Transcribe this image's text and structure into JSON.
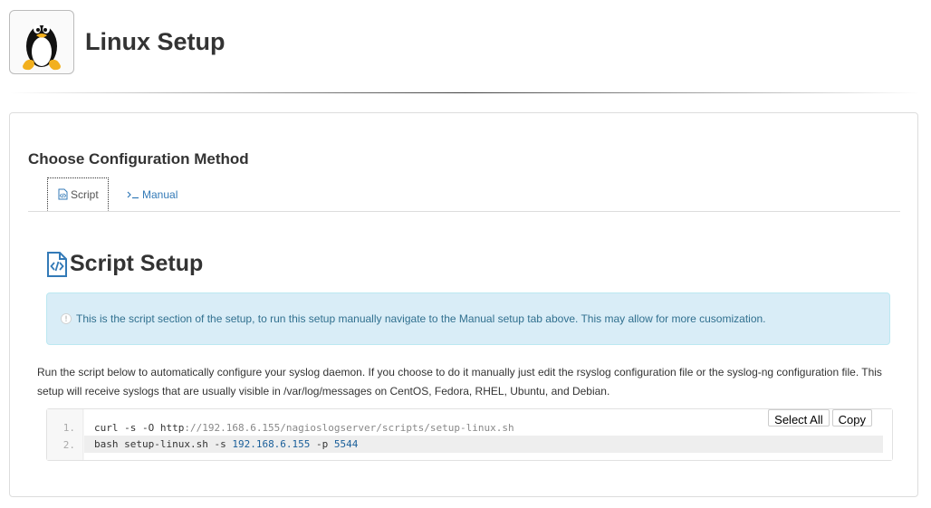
{
  "header": {
    "title": "Linux Setup",
    "logo_icon": "tux-penguin-icon"
  },
  "section": {
    "heading": "Choose Configuration Method"
  },
  "tabs": [
    {
      "label": "Script",
      "icon": "script-file-icon",
      "active": true
    },
    {
      "label": "Manual",
      "icon": "terminal-prompt-icon",
      "active": false
    }
  ],
  "script_panel": {
    "title": "Script Setup",
    "alert": "This is the script section of the setup, to run this setup manually navigate to the Manual setup tab above. This may allow for more cusomization.",
    "description": "Run the script below to automatically configure your syslog daemon. If you choose to do it manually just edit the rsyslog configuration file or the syslog-ng configuration file. This setup will receive syslogs that are usually visible in /var/log/messages on CentOS, Fedora, RHEL, Ubuntu, and Debian.",
    "code": {
      "line_numbers": [
        "1.",
        "2."
      ],
      "line1": {
        "cmd": "curl -s -O http",
        "rest": "://192.168.6.155/nagioslogserver/scripts/setup-linux.sh"
      },
      "line2": {
        "cmd": "bash setup-linux.sh -s ",
        "ip": "192.168.6.155",
        "flag": " -p ",
        "port": "5544"
      },
      "select_all_label": "Select All",
      "copy_label": "Copy"
    }
  },
  "colors": {
    "link": "#337ab7",
    "alert_bg": "#d9edf7",
    "alert_text": "#31708f"
  }
}
